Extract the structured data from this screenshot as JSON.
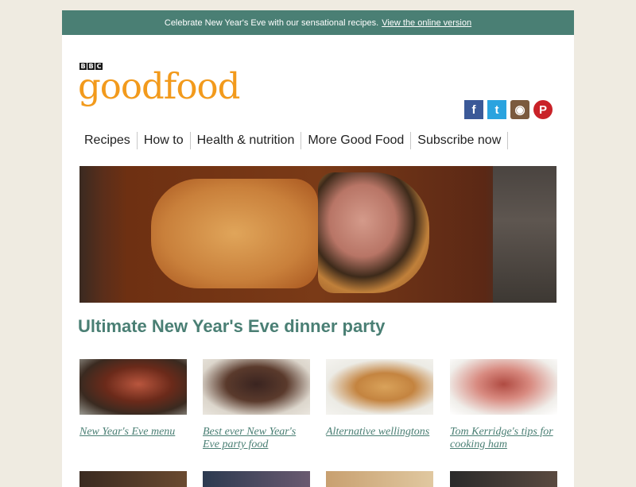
{
  "topbar": {
    "text": "Celebrate New Year's Eve with our sensational recipes.",
    "link": "View the online version"
  },
  "brand": {
    "bbc": [
      "B",
      "B",
      "C"
    ],
    "wordmark": "goodfood"
  },
  "social": {
    "facebook": "f",
    "twitter": "t",
    "instagram": "◉",
    "pinterest": "P"
  },
  "nav": [
    "Recipes",
    "How to",
    "Health & nutrition",
    "More Good Food",
    "Subscribe now"
  ],
  "headline": "Ultimate New Year's Eve dinner party",
  "cards": [
    {
      "caption": "New Year's Eve menu"
    },
    {
      "caption": "Best ever New Year's Eve party food"
    },
    {
      "caption": "Alternative wellingtons"
    },
    {
      "caption": "Tom Kerridge's tips for cooking ham"
    }
  ],
  "colors": {
    "accent": "#4a7f74",
    "brand": "#f29a1c",
    "background": "#efebe1"
  }
}
